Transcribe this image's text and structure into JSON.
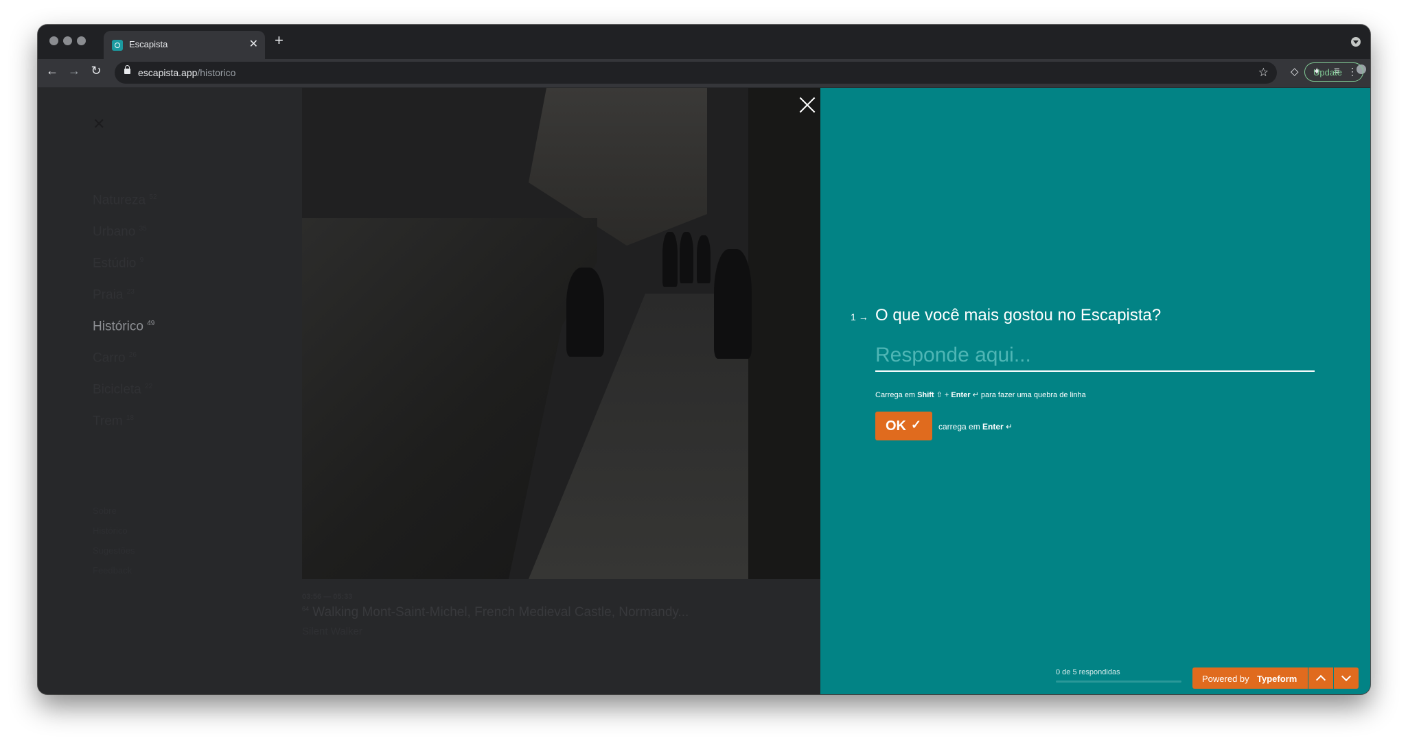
{
  "browser": {
    "tab_title": "Escapista",
    "tab_close": "✕",
    "new_tab": "+",
    "url_host": "escapista.app",
    "url_path": "/historico",
    "update_label": "Update"
  },
  "page": {
    "close": "✕",
    "categories": [
      {
        "label": "Natureza",
        "count": "52"
      },
      {
        "label": "Urbano",
        "count": "35"
      },
      {
        "label": "Estúdio",
        "count": "9"
      },
      {
        "label": "Praia",
        "count": "23"
      },
      {
        "label": "Histórico",
        "count": "49",
        "active": true
      },
      {
        "label": "Carro",
        "count": "26"
      },
      {
        "label": "Bicicleta",
        "count": "22"
      },
      {
        "label": "Trem",
        "count": "18"
      }
    ],
    "footer_links": [
      "Sobre",
      "Histórico",
      "Sugestões",
      "Feedback"
    ],
    "video": {
      "time_range": "03:56 — 05:33",
      "number": "64",
      "title": "Walking Mont-Saint-Michel, French Medieval Castle, Normandy...",
      "author": "Silent Walker"
    }
  },
  "typeform": {
    "background": "#028385",
    "accent": "#e06b1e",
    "question_number": "1",
    "question_arrow": "→",
    "question": "O que você mais gostou no Escapista?",
    "answer_placeholder": "Responde aqui...",
    "hint_prefix": "Carrega em ",
    "hint_shift": "Shift",
    "hint_shift_glyph": " ⇧ + ",
    "hint_enter": "Enter",
    "hint_suffix": " ↵ para fazer uma quebra de linha",
    "ok_label": "OK",
    "ok_check": "✓",
    "enter_hint_prefix": "carrega em ",
    "enter_hint_key": "Enter",
    "enter_hint_suffix": " ↵",
    "progress_text": "0 de 5 respondidas",
    "progress_fraction": 0,
    "powered_prefix": "Powered by",
    "powered_brand": "Typeform"
  }
}
